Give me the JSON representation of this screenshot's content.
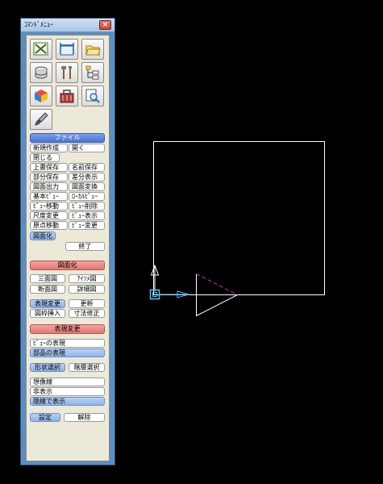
{
  "window": {
    "title": "ｺﾏﾝﾄﾞﾒﾆｭｰ",
    "close": "×"
  },
  "tools": [
    {
      "name": "edit-check-tool-icon"
    },
    {
      "name": "dimension-tool-icon"
    },
    {
      "name": "folder-open-tool-icon"
    },
    {
      "name": "layer-stack-tool-icon"
    },
    {
      "name": "hammer-tools-icon"
    },
    {
      "name": "tree-structure-tool-icon"
    },
    {
      "name": "cube-material-tool-icon"
    },
    {
      "name": "toolbox-tool-icon"
    },
    {
      "name": "inspect-tool-icon"
    },
    {
      "name": "brush-tool-icon"
    }
  ],
  "file_section": {
    "header": "ファイル",
    "rows": [
      [
        "新規作成",
        "開く"
      ],
      [
        "閉じる"
      ],
      [
        "上書保存",
        "名前保存"
      ],
      [
        "部分保存",
        "差分表示"
      ],
      [
        "図面出力",
        "図面変換"
      ],
      [
        "基本ﾋﾞｭｰ",
        "ﾛｰｶﾙﾋﾞｭｰ"
      ],
      [
        "ﾋﾞｭｰ移動",
        "ﾋﾞｭｰ削除"
      ],
      [
        "尺度変更",
        "ﾋﾞｭｰ表示"
      ],
      [
        "原点移動",
        "ﾋﾞｭｰ変更"
      ]
    ],
    "selected": "図面化",
    "exit": "終了"
  },
  "drawing_section": {
    "header": "図面化",
    "rows": [
      [
        "三面図",
        "ｱｲｿﾒ図"
      ],
      [
        "断面図",
        "詳細図"
      ]
    ]
  },
  "display_row1": [
    "表現変更",
    "更新"
  ],
  "display_row2": [
    "図枠挿入",
    "寸法修正"
  ],
  "expression_section": {
    "header": "表現変更",
    "view_expr": "ﾋﾞｭｰの表現",
    "part_expr": "部品の表現"
  },
  "select_row": [
    "形状選択",
    "階層選択"
  ],
  "line_opts": [
    "想像線",
    "非表示",
    "隠線で表示"
  ],
  "bottom_row": [
    "設定",
    "解除"
  ],
  "colors": {
    "panel_frame": "#5b8fc0",
    "panel_body": "#ece9d8",
    "section_blue": "#4a74d4",
    "section_red": "#e37772",
    "canvas_bg": "#000000",
    "axis_color": "#4fc3f7",
    "drawing_line": "#ffffff",
    "dash_line": "#c42fbc"
  }
}
